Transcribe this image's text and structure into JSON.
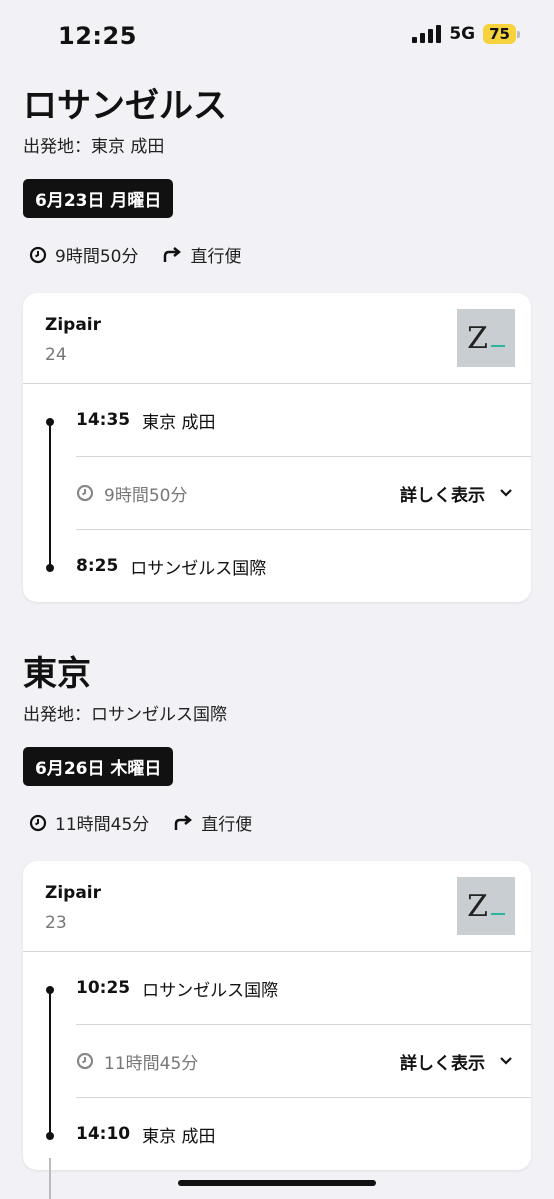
{
  "status": {
    "time": "12:25",
    "network": "5G",
    "battery": "75"
  },
  "legs": [
    {
      "destination": "ロサンゼルス",
      "origin_label": "出発地：東京 成田",
      "date": "6月23日 月曜日",
      "duration": "9時間50分",
      "type": "直行便",
      "airline": "Zipair",
      "flight_number": "24",
      "logo_text": "Z",
      "departure": {
        "time": "14:35",
        "place": "東京 成田"
      },
      "flight_duration": "9時間50分",
      "details_label": "詳しく表示",
      "arrival": {
        "time": "8:25",
        "place": "ロサンゼルス国際"
      }
    },
    {
      "destination": "東京",
      "origin_label": "出発地：ロサンゼルス国際",
      "date": "6月26日 木曜日",
      "duration": "11時間45分",
      "type": "直行便",
      "airline": "Zipair",
      "flight_number": "23",
      "logo_text": "Z",
      "departure": {
        "time": "10:25",
        "place": "ロサンゼルス国際"
      },
      "flight_duration": "11時間45分",
      "details_label": "詳しく表示",
      "arrival": {
        "time": "14:10",
        "place": "東京 成田"
      }
    }
  ],
  "colors": {
    "accent_logo": "#2ab69b",
    "chip_bg": "#111111"
  }
}
